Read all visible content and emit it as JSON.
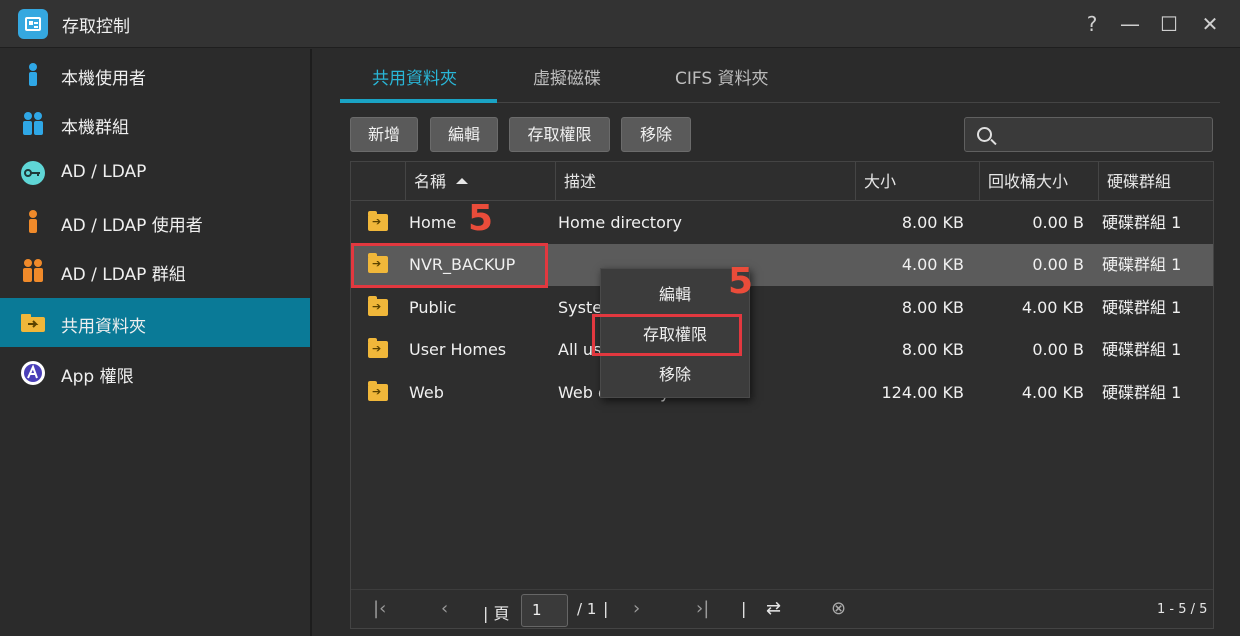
{
  "window": {
    "title": "存取控制",
    "help_glyph": "?",
    "minimize_glyph": "—",
    "maximize_glyph": "☐",
    "close_glyph": "✕"
  },
  "sidebar": {
    "items": [
      {
        "label": "本機使用者",
        "icon": "user-icon"
      },
      {
        "label": "本機群組",
        "icon": "group-icon"
      },
      {
        "label": "AD / LDAP",
        "icon": "key-icon"
      },
      {
        "label": "AD / LDAP 使用者",
        "icon": "user-icon"
      },
      {
        "label": "AD / LDAP 群組",
        "icon": "group-icon"
      },
      {
        "label": "共用資料夾",
        "icon": "shared-folder-icon"
      },
      {
        "label": "App 權限",
        "icon": "app-icon"
      }
    ],
    "active_index": 5
  },
  "tabs": [
    "共用資料夾",
    "虛擬磁碟",
    "CIFS 資料夾"
  ],
  "toolbar": {
    "add": "新增",
    "edit": "編輯",
    "access": "存取權限",
    "remove": "移除",
    "search_placeholder": ""
  },
  "table": {
    "headers": [
      "名稱",
      "描述",
      "大小",
      "回收桶大小",
      "硬碟群組"
    ],
    "rows": [
      {
        "name": "Home",
        "desc": "Home directory",
        "size": "8.00 KB",
        "recycle": "0.00 B",
        "group": "硬碟群組 1"
      },
      {
        "name": "NVR_BACKUP",
        "desc": "",
        "size": "4.00 KB",
        "recycle": "0.00 B",
        "group": "硬碟群組 1"
      },
      {
        "name": "Public",
        "desc": "System default share",
        "size": "8.00 KB",
        "recycle": "4.00 KB",
        "group": "硬碟群組 1"
      },
      {
        "name": "User Homes",
        "desc": "All user homes",
        "size": "8.00 KB",
        "recycle": "0.00 B",
        "group": "硬碟群組 1"
      },
      {
        "name": "Web",
        "desc": "Web directory",
        "size": "124.00 KB",
        "recycle": "4.00 KB",
        "group": "硬碟群組 1"
      }
    ],
    "selected_index": 1
  },
  "pager": {
    "page_label": "頁",
    "current_page": "1",
    "total_label": "/ 1",
    "range": "1 - 5 / 5"
  },
  "context_menu": [
    "編輯",
    "存取權限",
    "移除"
  ],
  "annotations": {
    "step_a": "5",
    "step_b": "5"
  },
  "colors": {
    "accent": "#1aa3c4",
    "sidebar_active": "#0a7a97",
    "highlight": "#e2383f",
    "folder": "#f0b73a"
  }
}
